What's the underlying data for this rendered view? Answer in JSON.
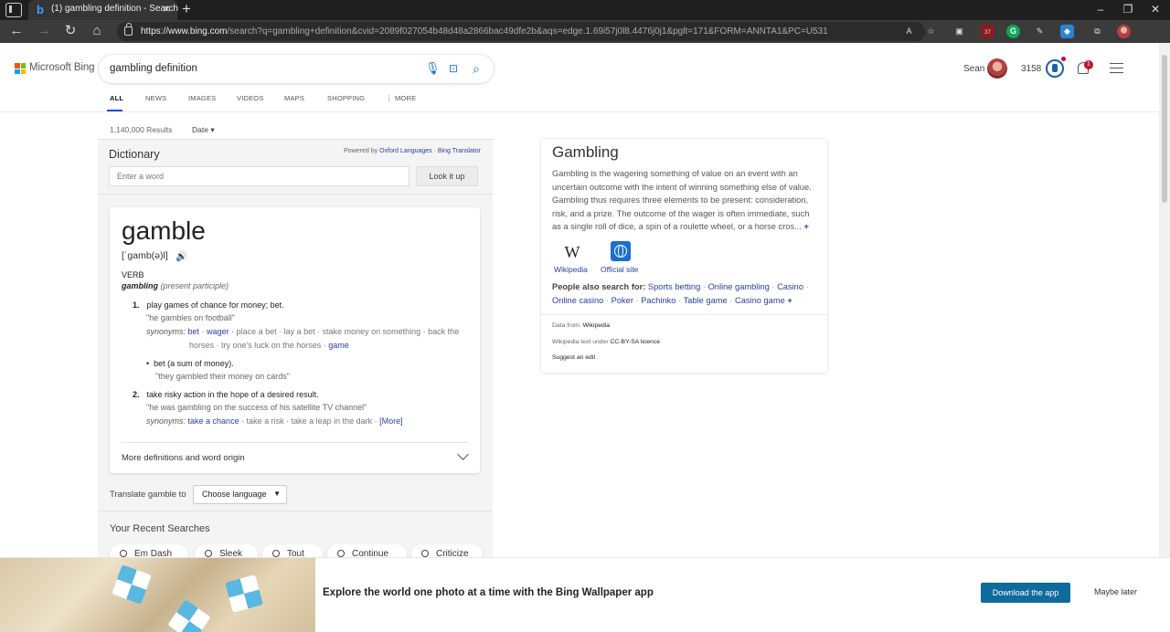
{
  "browser": {
    "tab_title": "(1) gambling definition - Search",
    "url_host": "https://www.bing.com",
    "url_rest": "/search?q=gambling+definition&cvid=2089f027054b48d48a2866bac49dfe2b&aqs=edge.1.69i57j0l8.4476j0j1&pglt=171&FORM=ANNTA1&PC=U531",
    "extension_badge": "37"
  },
  "header": {
    "logo_text": "Microsoft Bing",
    "query": "gambling definition",
    "user_name": "Sean",
    "points": "3158",
    "notification_count": "1"
  },
  "scopes": [
    "ALL",
    "NEWS",
    "IMAGES",
    "VIDEOS",
    "MAPS",
    "SHOPPING",
    "⋮ MORE"
  ],
  "results": {
    "count": "1,140,000 Results",
    "date_filter": "Date ▾"
  },
  "dictionary": {
    "title": "Dictionary",
    "powered_prefix": "Powered by ",
    "powered_oxford": "Oxford Languages",
    "powered_sep": " · ",
    "powered_bing": "Bing Translator",
    "input_placeholder": "Enter a word",
    "lookup_label": "Look it up",
    "headword": "gamble",
    "phonetic": "[ˈɡamb(ə)l]",
    "pos": "VERB",
    "inflection_word": "gambling",
    "inflection_note": "(present participle)",
    "sense1": "play games of chance for money; bet.",
    "sense1_example": "\"he gambles on football\"",
    "synonyms_label": "synonyms:",
    "sense1_syn_bet": "bet",
    "sense1_syn_wager": "wager",
    "sense1_syn_rest": " · place a bet · lay a bet · stake money on something · back the",
    "sense1_syn_line2": "horses · try one's luck on the horses · ",
    "sense1_syn_game": "game",
    "sub1": "bet (a sum of money).",
    "sub1_example": "\"they gambled their money on cards\"",
    "sense2": "take risky action in the hope of a desired result.",
    "sense2_example": "\"he was gambling on the success of his satellite TV channel\"",
    "sense2_syn_link": "take a chance",
    "sense2_syn_rest": " · take a risk · take a leap in the dark · ",
    "sense2_more": "[More]",
    "more_defs": "More definitions and word origin",
    "translate_label": "Translate gamble to",
    "language_select": "Choose language",
    "recent_title": "Your Recent Searches",
    "recent": [
      "Em Dash",
      "Sleek",
      "Tout",
      "Continue",
      "Criticize"
    ]
  },
  "knowledge_panel": {
    "title": "Gambling",
    "description": "Gambling is the wagering something of value on an event with an uncertain outcome with the intent of winning something else of value. Gambling thus requires three elements to be present: consideration, risk, and a prize. The outcome of the wager is often immediate, such as a single roll of dice, a spin of a roulette wheel, or a horse cros...",
    "expand": "+",
    "links": [
      "Wikipedia",
      "Official site"
    ],
    "people_also_label": "People also search for:",
    "people_also": [
      "Sports betting",
      "Online gambling",
      "Casino",
      "Online casino",
      "Poker",
      "Pachinko",
      "Table game",
      "Casino game"
    ],
    "more": "+",
    "data_from_label": "Data from: ",
    "data_from_value": "Wikipedia",
    "licence_label": "Wikipedia text under ",
    "licence_value": "CC-BY-SA licence",
    "suggest_edit": "Suggest an edit"
  },
  "banner": {
    "text": "Explore the world one photo at a time with the Bing Wallpaper app",
    "download_label": "Download the app",
    "maybe_label": "Maybe later"
  },
  "colors": {
    "accent_blue": "#174ae4",
    "link_blue": "#2a3fa0",
    "banner_button": "#0f6b9b",
    "badge_red": "#c8102e"
  }
}
